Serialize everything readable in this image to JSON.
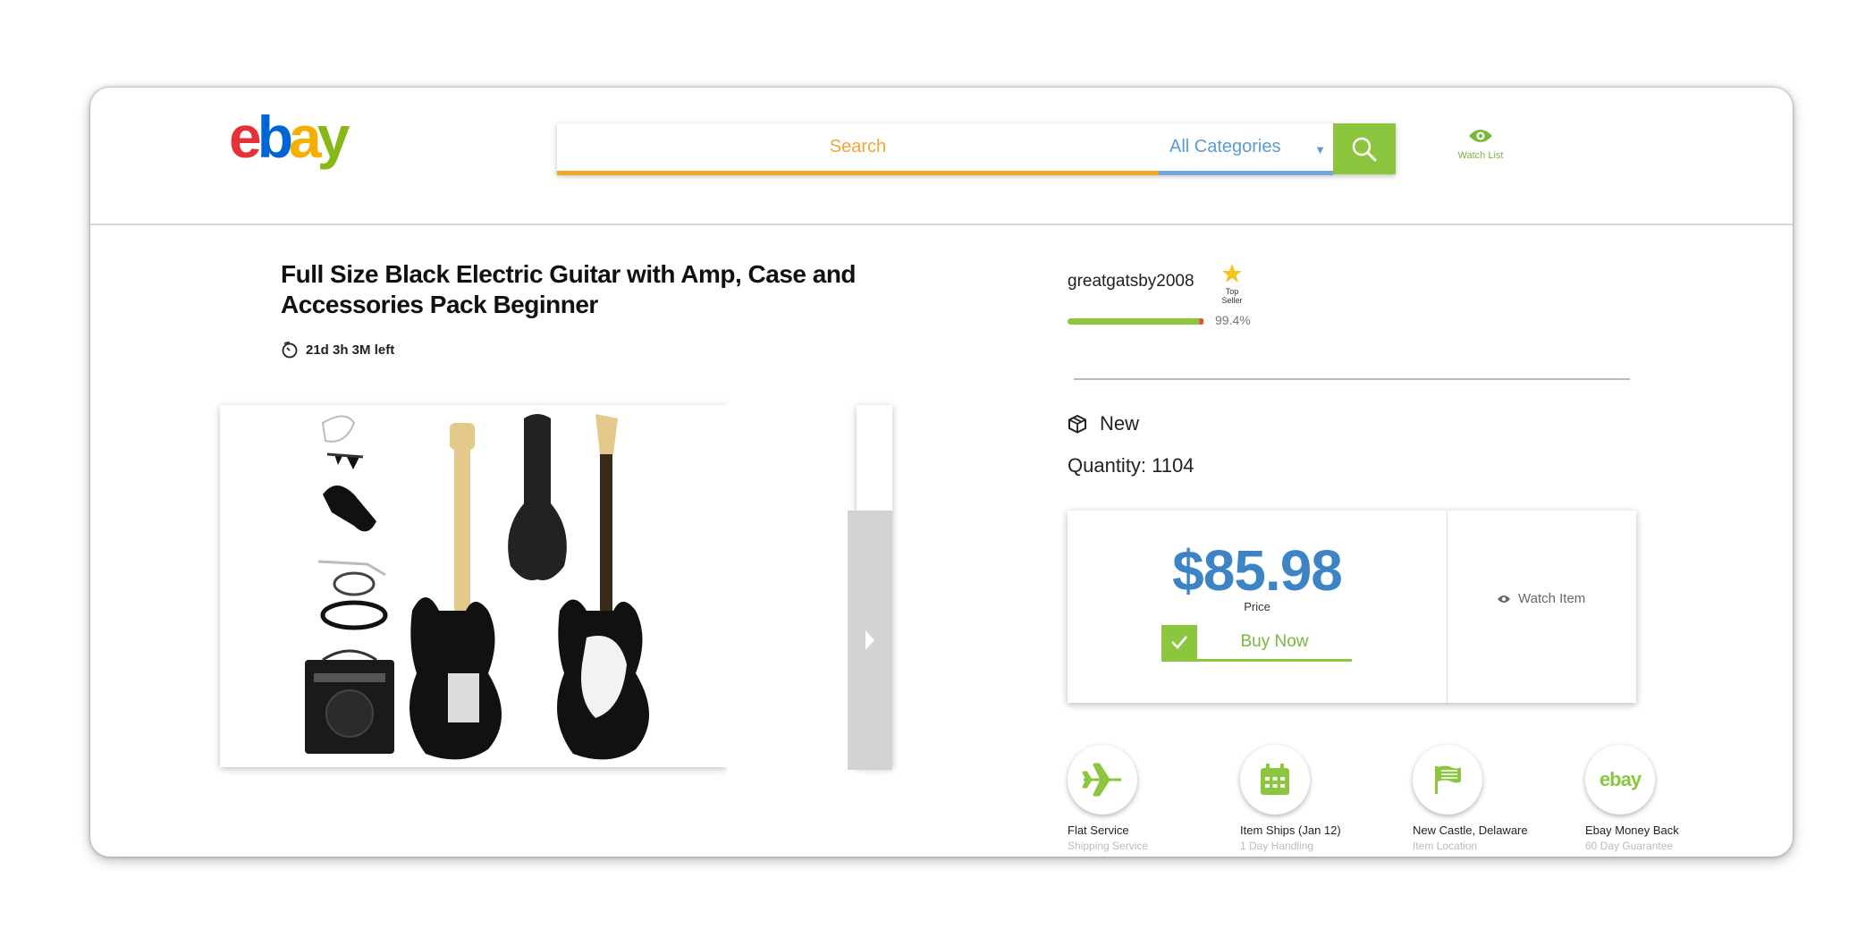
{
  "header": {
    "logo_letters": [
      "e",
      "b",
      "a",
      "y"
    ],
    "search_placeholder": "Search",
    "category": "All Categories",
    "watchlist_label": "Watch List"
  },
  "product": {
    "title": "Full Size Black Electric Guitar with Amp, Case and Accessories Pack Beginner",
    "time_left": "21d 3h 3M left",
    "image_icon": "guitar-kit-image"
  },
  "seller": {
    "name": "greatgatsby2008",
    "badge": "Top Seller",
    "feedback_percent": "99.4%",
    "feedback_fraction": 0.994
  },
  "listing": {
    "condition": "New",
    "quantity": "Quantity: 1104",
    "price": "$85.98",
    "price_label": "Price",
    "buy_label": "Buy Now",
    "watch_label": "Watch Item"
  },
  "features": [
    {
      "title": "Flat Service",
      "subtitle": "Shipping Service",
      "icon": "airplane-icon"
    },
    {
      "title": "Item Ships (Jan 12)",
      "subtitle": "1 Day Handling",
      "icon": "calendar-icon"
    },
    {
      "title": "New Castle, Delaware",
      "subtitle": "Item Location",
      "icon": "flag-icon"
    },
    {
      "title": "Ebay Money Back",
      "subtitle": "60 Day Guarantee",
      "icon": "ebay-icon",
      "icon_text": "ebay"
    }
  ],
  "colors": {
    "accent_green": "#8cc63f",
    "price_blue": "#3d84c6",
    "search_orange": "#f5a623",
    "category_blue": "#6fa8dc"
  }
}
